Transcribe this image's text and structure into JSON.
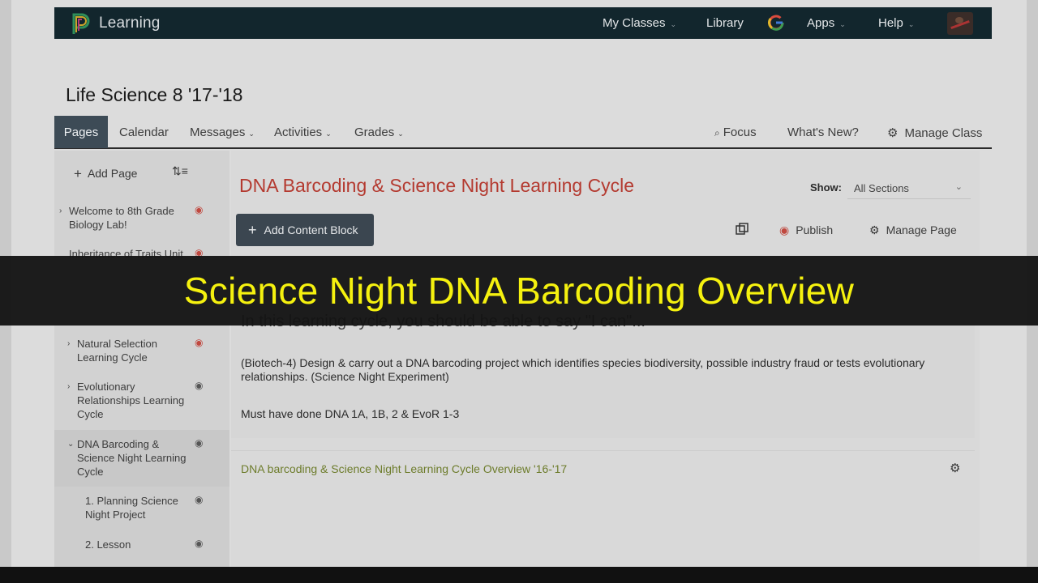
{
  "navbar": {
    "brand": "Learning",
    "items": [
      {
        "label": "My Classes"
      },
      {
        "label": "Library"
      },
      {
        "label": "Apps"
      },
      {
        "label": "Help"
      }
    ]
  },
  "class": {
    "title": "Life Science 8 '17-'18"
  },
  "tabs": {
    "active": "Pages",
    "items": [
      "Calendar",
      "Messages",
      "Activities",
      "Grades"
    ],
    "right": [
      "Focus",
      "What's New?",
      "Manage Class"
    ]
  },
  "sidebar": {
    "add_page": "Add Page",
    "items": [
      {
        "label": "Welcome to 8th Grade Biology Lab!"
      },
      {
        "label": "Inheritance of Traits Unit"
      },
      {
        "label": "Natural Selection Learning Cycle"
      },
      {
        "label": "Evolutionary Relationships Learning Cycle"
      },
      {
        "label": "DNA Barcoding & Science Night Learning Cycle"
      },
      {
        "label": "1. Planning Science Night Project"
      },
      {
        "label": "2. Lesson"
      }
    ]
  },
  "content": {
    "title": "DNA Barcoding & Science Night Learning Cycle",
    "show_label": "Show:",
    "show_value": "All Sections",
    "add_block": "Add Content Block",
    "publish": "Publish",
    "manage_page": "Manage Page",
    "intro": "In this learning cycle, you should be able to say \"I can\"...",
    "objective": "(Biotech-4) Design & carry out a DNA barcoding project which identifies species biodiversity, possible industry fraud or tests evolutionary relationships. (Science Night Experiment)",
    "prereq": "Must have done DNA 1A, 1B, 2 & EvoR 1-3",
    "link": "DNA barcoding & Science Night Learning Cycle Overview '16-'17"
  },
  "caption": "Science Night DNA Barcoding Overview",
  "colors": {
    "navbar": "#12262d",
    "title_red": "#b43a30",
    "link_green": "#6d7c2b",
    "caption_yellow": "#f5f10f"
  }
}
